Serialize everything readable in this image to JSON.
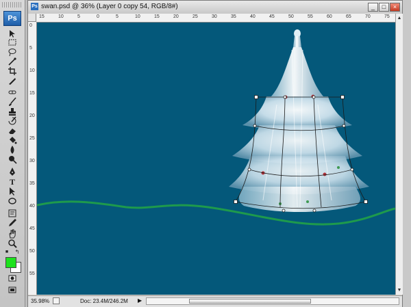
{
  "app": {
    "logo": "Ps"
  },
  "document": {
    "title": "swan.psd @ 36% (Layer 0 copy 54, RGB/8#)",
    "icon_label": "Ps"
  },
  "window_buttons": {
    "minimize": "_",
    "maximize": "□",
    "close": "×"
  },
  "ruler": {
    "horizontal_labels": [
      "15",
      "10",
      "5",
      "0",
      "5",
      "10",
      "15",
      "20",
      "25",
      "30",
      "35",
      "40",
      "45",
      "50",
      "55",
      "60",
      "65",
      "70",
      "75"
    ],
    "vertical_labels": [
      "0",
      "5",
      "10",
      "15",
      "20",
      "25",
      "30",
      "35",
      "40",
      "45",
      "50",
      "55"
    ]
  },
  "status": {
    "zoom": "35.98%",
    "doc_info": "Doc: 23.4M/246.2M"
  },
  "colors": {
    "canvas_bg": "#04587a",
    "foreground": "#1de21d",
    "background": "#ffffff",
    "green_line": "#1e9a4c"
  },
  "tools": [
    "move-tool",
    "marquee-tool",
    "lasso-tool",
    "magic-wand-tool",
    "crop-tool",
    "slice-tool",
    "healing-brush-tool",
    "brush-tool",
    "clone-stamp-tool",
    "history-brush-tool",
    "eraser-tool",
    "paint-bucket-tool",
    "blur-tool",
    "dodge-tool",
    "pen-tool",
    "type-tool",
    "path-selection-tool",
    "shape-tool",
    "notes-tool",
    "eyedropper-tool",
    "hand-tool",
    "zoom-tool",
    "quick-mask-tool",
    "screen-mode-tool"
  ]
}
